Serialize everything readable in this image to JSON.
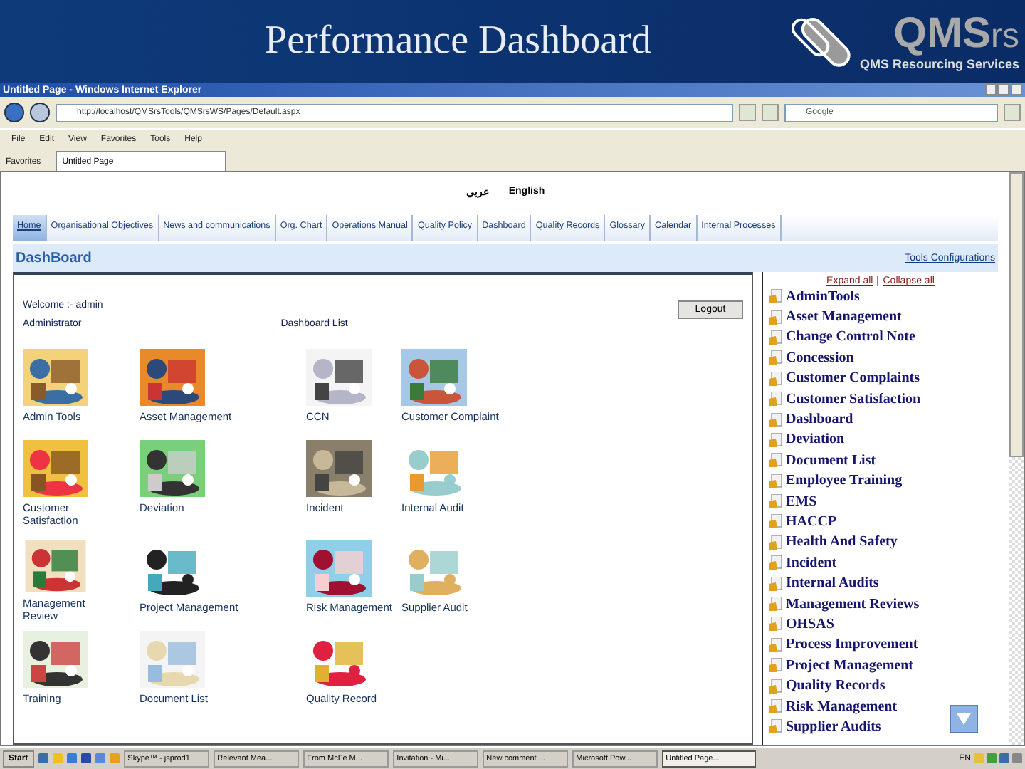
{
  "slide": {
    "title": "Performance Dashboard",
    "logo_main": "QMS",
    "logo_suffix": "rs",
    "logo_tagline": "QMS Resourcing Services"
  },
  "browser": {
    "title": "Untitled Page - Windows Internet Explorer",
    "address": "http://localhost/QMSrsTools/QMSrsWS/Pages/Default.aspx",
    "search_placeholder": "Google",
    "menu": [
      "File",
      "Edit",
      "View",
      "Favorites",
      "Tools",
      "Help"
    ],
    "favorites": "Favorites",
    "tab": "Untitled Page"
  },
  "page": {
    "languages": [
      "عربي",
      "English"
    ],
    "nav": [
      {
        "label": "Home",
        "selected": true
      },
      {
        "label": "Organisational Objectives",
        "selected": false
      },
      {
        "label": "News and communications",
        "selected": false
      },
      {
        "label": "Org. Chart",
        "selected": false
      },
      {
        "label": "Operations Manual",
        "selected": false
      },
      {
        "label": "Quality Policy",
        "selected": false
      },
      {
        "label": "Dashboard",
        "selected": false
      },
      {
        "label": "Quality Records",
        "selected": false
      },
      {
        "label": "Glossary",
        "selected": false
      },
      {
        "label": "Calendar",
        "selected": false
      },
      {
        "label": "Internal Processes",
        "selected": false
      }
    ],
    "heading": "DashBoard",
    "tools_link": "Tools Configurations",
    "welcome": "Welcome :- admin",
    "role": "Administrator",
    "list_title": "Dashboard List",
    "logout": "Logout",
    "tiles": [
      {
        "label": "Admin Tools"
      },
      {
        "label": "Asset Management"
      },
      {
        "label": "CCN"
      },
      {
        "label": "Customer Complaint"
      },
      {
        "label": "Customer Satisfaction"
      },
      {
        "label": "Deviation"
      },
      {
        "label": "Incident"
      },
      {
        "label": "Internal Audit"
      },
      {
        "label": "Management Review"
      },
      {
        "label": "Project Management"
      },
      {
        "label": "Risk Management"
      },
      {
        "label": "Supplier Audit"
      },
      {
        "label": "Training"
      },
      {
        "label": "Document List"
      },
      {
        "label": "Quality Record"
      }
    ],
    "expand_all": "Expand all",
    "collapse_all": "Collapse all",
    "tree": [
      "AdminTools",
      "Asset Management",
      "Change Control Note",
      "Concession",
      "Customer Complaints",
      "Customer Satisfaction",
      "Dashboard",
      "Deviation",
      "Document List",
      "Employee Training",
      "EMS",
      "HACCP",
      "Health And Safety",
      "Incident",
      "Internal Audits",
      "Management Reviews",
      "OHSAS",
      "Process Improvement",
      "Project Management",
      "Quality Records",
      "Risk Management",
      "Supplier Audits"
    ]
  },
  "taskbar": {
    "start": "Start",
    "items": [
      {
        "label": "Skype™ - jsprod1",
        "selected": false
      },
      {
        "label": "Relevant Mea...",
        "selected": false
      },
      {
        "label": "From McFe M...",
        "selected": false
      },
      {
        "label": "Invitation - Mi...",
        "selected": false
      },
      {
        "label": "New comment ...",
        "selected": false
      },
      {
        "label": "Microsoft Pow...",
        "selected": false
      },
      {
        "label": "Untitled Page...",
        "selected": true
      }
    ],
    "language": "EN"
  }
}
